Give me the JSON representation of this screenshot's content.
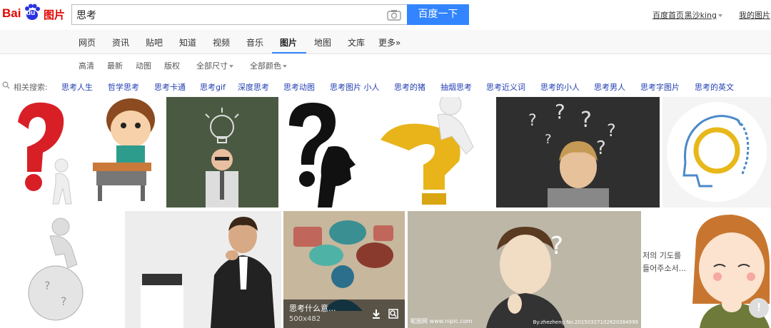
{
  "logo": {
    "bai": "Bai",
    "du": "du",
    "img": "图片"
  },
  "search": {
    "query": "思考",
    "button_label": "百度一下"
  },
  "top_links": [
    {
      "label": "百度首页"
    },
    {
      "label": "黑沙king"
    },
    {
      "label": "我的图片"
    }
  ],
  "tabs": [
    {
      "label": "网页"
    },
    {
      "label": "资讯"
    },
    {
      "label": "贴吧"
    },
    {
      "label": "知道"
    },
    {
      "label": "视频"
    },
    {
      "label": "音乐"
    },
    {
      "label": "图片",
      "active": true
    },
    {
      "label": "地图"
    },
    {
      "label": "文库"
    },
    {
      "label": "更多»"
    }
  ],
  "filters": [
    {
      "label": "高清"
    },
    {
      "label": "最新"
    },
    {
      "label": "动图"
    },
    {
      "label": "版权"
    },
    {
      "label": "全部尺寸"
    },
    {
      "label": "全部颜色"
    }
  ],
  "related": {
    "label": "相关搜索:",
    "links": [
      "思考人生",
      "哲学思考",
      "思考卡通",
      "思考gif",
      "深度思考",
      "思考动图",
      "思考图片 小人",
      "思考的猪",
      "抽烟思考",
      "思考近义词",
      "思考的小人",
      "思考男人",
      "思考字图片",
      "思考的英文"
    ]
  },
  "hover_card": {
    "title": "思考什么意...",
    "size": "500x482"
  },
  "watermarks": {
    "nipic": "昵图网 www.nipic.com",
    "nipic_id": "By:zhezheng No.20150327102820384999"
  },
  "korean_caption": [
    "저의 기도를",
    "들어주소서..."
  ],
  "feedback_label": "!",
  "colors": {
    "accent": "#3385ff",
    "link": "#2440b3",
    "brand_red": "#e10602"
  }
}
